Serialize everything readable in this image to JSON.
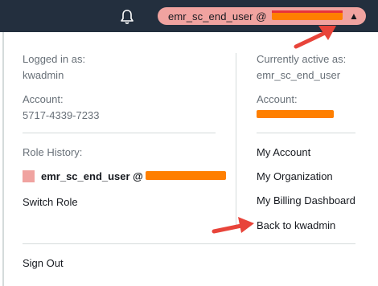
{
  "header": {
    "user_label": "emr_sc_end_user @",
    "caret": "▲",
    "bell_icon": "bell-icon",
    "pill_color": "#f0a3a0"
  },
  "left": {
    "logged_in_label": "Logged in as:",
    "logged_in_user": "kwadmin",
    "account_label": "Account:",
    "account_id": "5717-4339-7233",
    "role_history_label": "Role History:",
    "role_entry": "emr_sc_end_user @",
    "switch_role": "Switch Role"
  },
  "right": {
    "active_label": "Currently active as:",
    "active_user": "emr_sc_end_user",
    "account_label": "Account:",
    "links": [
      "My Account",
      "My Organization",
      "My Billing Dashboard",
      "Back to kwadmin"
    ]
  },
  "footer": {
    "sign_out": "Sign Out"
  },
  "colors": {
    "topbar": "#232f3e",
    "redaction": "#ff7f00",
    "annotation_arrow": "#e8443a"
  }
}
